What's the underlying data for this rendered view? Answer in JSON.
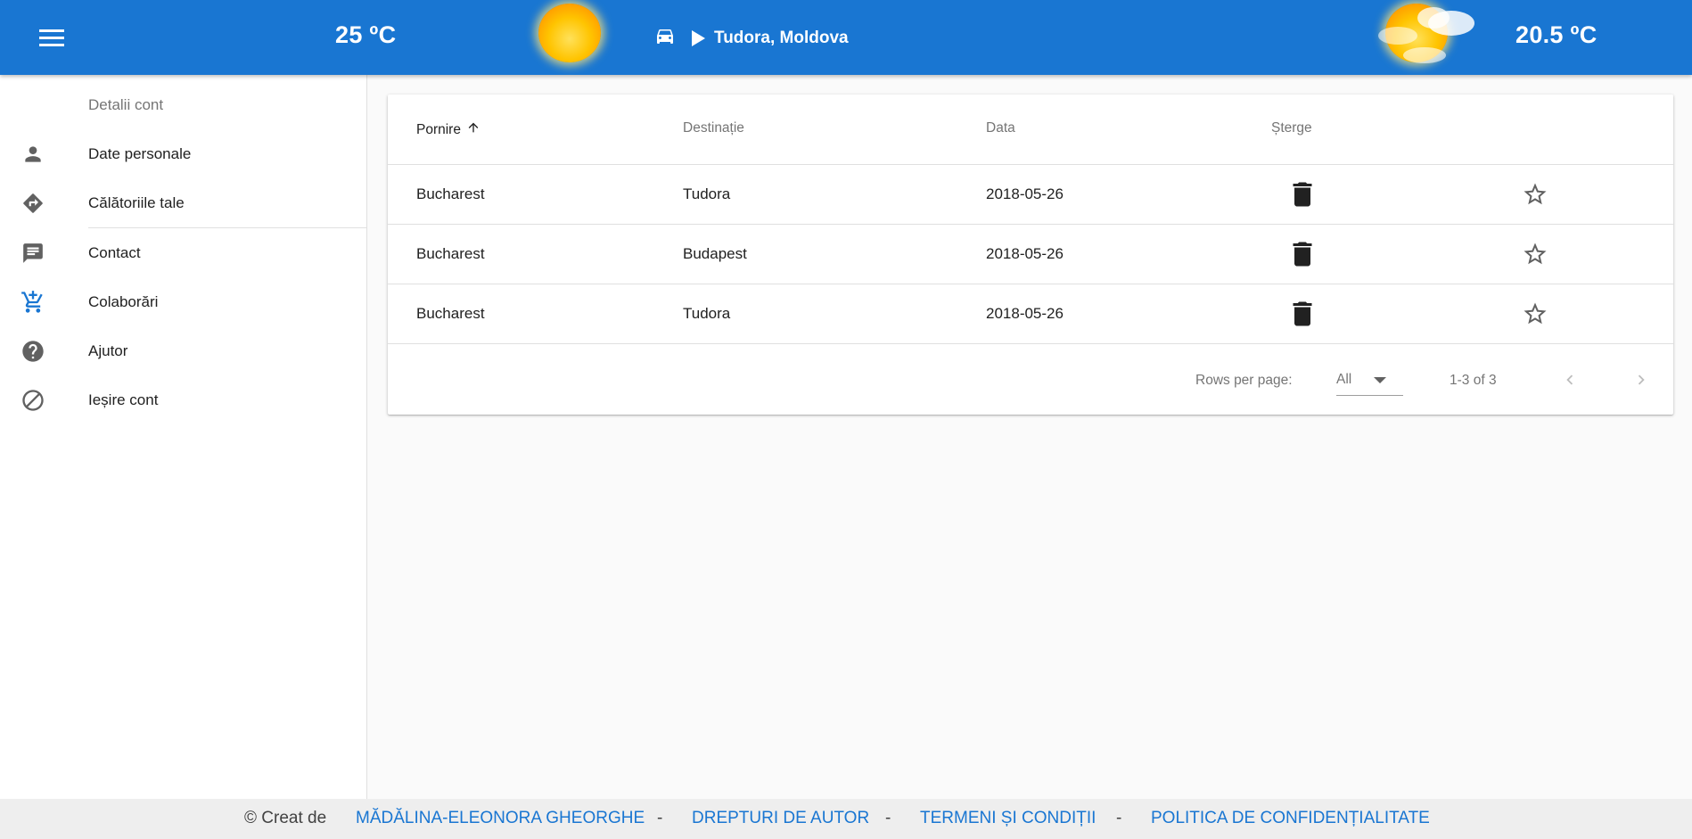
{
  "header": {
    "temp_left": "25 ºC",
    "temp_right": "20.5 ºC",
    "route_label": "Tudora, Moldova",
    "icons": [
      "menu-icon",
      "sun-icon",
      "car-icon",
      "play-arrow-icon",
      "sun-cloud-icon"
    ],
    "color": "#1976d2"
  },
  "sidebar": {
    "header": "Detalii cont",
    "items": [
      {
        "label": "Date personale",
        "icon": "person-icon"
      },
      {
        "label": "Călătoriile tale",
        "icon": "directions-icon"
      },
      {
        "label": "Contact",
        "icon": "message-icon"
      },
      {
        "label": "Colaborări",
        "icon": "add-shopping-cart-icon"
      },
      {
        "label": "Ajutor",
        "icon": "help-icon"
      },
      {
        "label": "Ieșire cont",
        "icon": "block-icon"
      }
    ]
  },
  "table": {
    "columns": [
      "Pornire",
      "Destinație",
      "Data",
      "Șterge"
    ],
    "sort_column": "Pornire",
    "rows": [
      {
        "pornire": "Bucharest",
        "destinatie": "Tudora",
        "data": "2018-05-26"
      },
      {
        "pornire": "Bucharest",
        "destinatie": "Budapest",
        "data": "2018-05-26"
      },
      {
        "pornire": "Bucharest",
        "destinatie": "Tudora",
        "data": "2018-05-26"
      }
    ],
    "pagination": {
      "rows_per_page_label": "Rows per page:",
      "rows_per_page_value": "All",
      "range": "1-3 of 3"
    }
  },
  "footer": {
    "copyright": "© Creat de",
    "author": "MĂDĂLINA-ELEONORA GHEORGHE",
    "separator": "-",
    "copyright_link": "DREPTURI DE AUTOR",
    "terms_link": "TERMENI ȘI CONDIȚII",
    "privacy_link": "POLITICA DE CONFIDENȚIALITATE"
  }
}
